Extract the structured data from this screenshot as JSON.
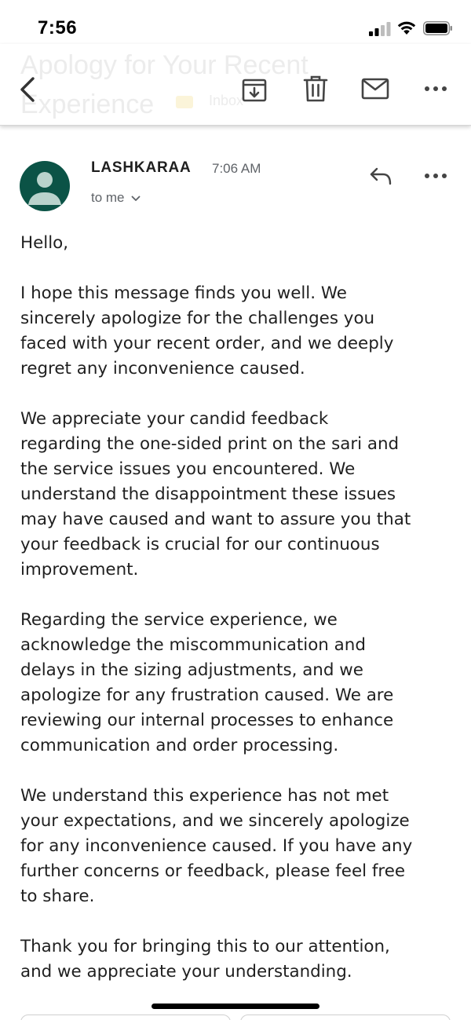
{
  "status_bar": {
    "time": "7:56"
  },
  "toolbar": {
    "subject": "Apology for Your Recent Experience",
    "label": "Inbox",
    "icons": [
      "back-arrow",
      "archive",
      "trash",
      "mail-unread",
      "more-horizontal"
    ]
  },
  "message": {
    "sender": "LASHKARAA",
    "time": "7:06 AM",
    "recipient": "to me",
    "avatar_color": "#0b5346",
    "body": {
      "greeting": "Hello,",
      "p1": [
        "I hope this message finds you well. We",
        "sincerely apologize for the challenges you",
        "faced with your recent order, and we deeply",
        "regret any inconvenience caused."
      ],
      "p2": [
        "We appreciate your candid feedback",
        "regarding the one-sided print on the sari and",
        "the service issues you encountered. We",
        "understand the disappointment these issues",
        "may have caused and want to assure you that",
        "your feedback is crucial for our continuous",
        "improvement."
      ],
      "p3": [
        "Regarding the service experience, we",
        "acknowledge the miscommunication and",
        "delays in the sizing adjustments, and we",
        "apologize for any frustration caused. We are",
        "reviewing our internal processes to enhance",
        "communication and order processing."
      ],
      "p4": [
        "We understand this experience has not met",
        "your expectations, and we sincerely apologize",
        "for any inconvenience caused. If you have any",
        "further concerns or feedback, please feel free",
        "to share."
      ],
      "p5": [
        "Thank you for bringing this to our attention,",
        "and we appreciate your understanding."
      ]
    }
  }
}
